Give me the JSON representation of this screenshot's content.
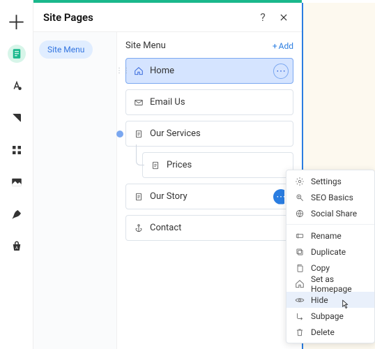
{
  "leftbar": {
    "items": [
      "plus",
      "pages",
      "text",
      "contrast",
      "apps",
      "image",
      "pen",
      "store"
    ]
  },
  "panel": {
    "title": "Site Pages",
    "left_pill": "Site Menu",
    "section_title": "Site Menu",
    "add_label": "Add"
  },
  "pages": [
    {
      "label": "Home",
      "icon": "home",
      "state": "home",
      "more": "light"
    },
    {
      "label": "Email Us",
      "icon": "mail"
    },
    {
      "label": "Our Services",
      "icon": "page",
      "tree": "dot"
    },
    {
      "label": "Prices",
      "icon": "page",
      "indent": true,
      "tree": "line"
    },
    {
      "label": "Our Story",
      "icon": "page",
      "more": "solidclip"
    },
    {
      "label": "Contact",
      "icon": "anchor"
    }
  ],
  "ctx": {
    "groups": [
      [
        "Settings",
        "SEO Basics",
        "Social Share"
      ],
      [
        "Rename",
        "Duplicate",
        "Copy",
        "Set as Homepage",
        "Hide",
        "Subpage",
        "Delete"
      ]
    ],
    "icons": {
      "Settings": "gear",
      "SEO Basics": "seo",
      "Social Share": "share",
      "Rename": "rename",
      "Duplicate": "dup",
      "Copy": "copy",
      "Set as Homepage": "home",
      "Hide": "eye",
      "Subpage": "sub",
      "Delete": "trash"
    },
    "hover": "Hide"
  }
}
